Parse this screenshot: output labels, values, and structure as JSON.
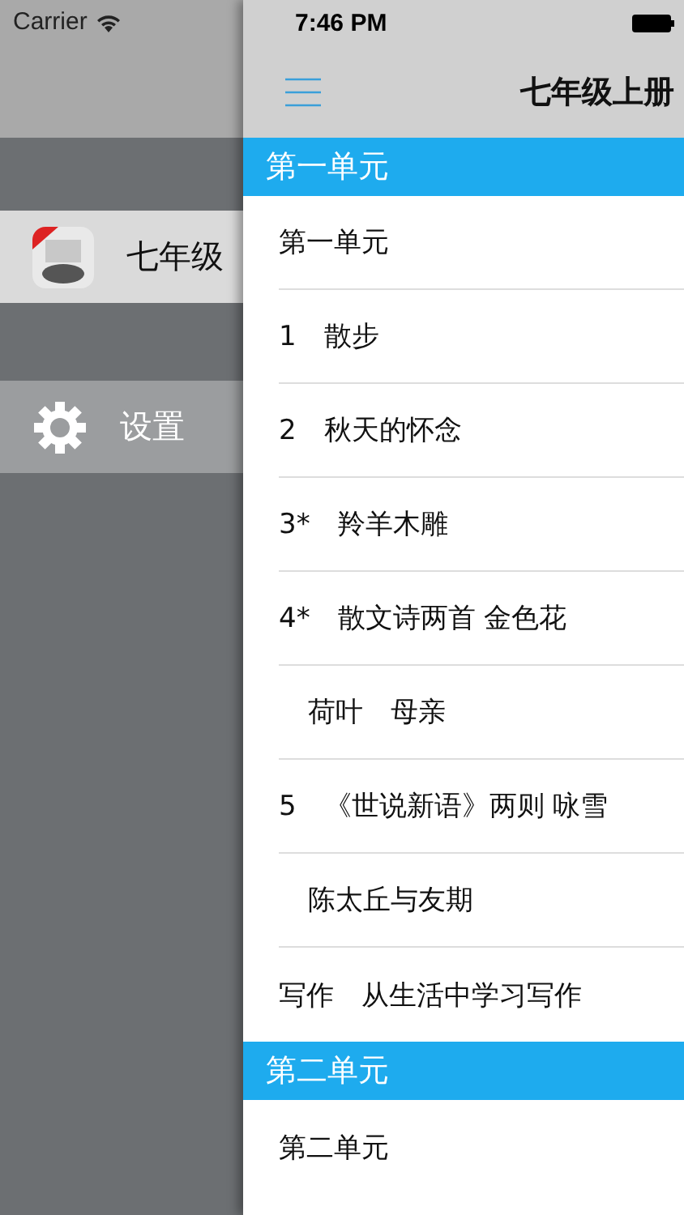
{
  "drawer": {
    "carrier": "Carrier",
    "items": [
      {
        "kind": "book",
        "label": "七年级",
        "selected": true
      },
      {
        "kind": "settings",
        "label": "设置",
        "selected": false
      }
    ]
  },
  "main": {
    "time": "7:46 PM",
    "title": "七年级上册",
    "sections": [
      {
        "header": "第一单元",
        "rows": [
          {
            "text": "第一单元",
            "indent": false
          },
          {
            "text": "1　散步",
            "indent": false
          },
          {
            "text": "2　秋天的怀念",
            "indent": false
          },
          {
            "text": "3*　羚羊木雕",
            "indent": false
          },
          {
            "text": "4*　散文诗两首 金色花",
            "indent": false
          },
          {
            "text": "荷叶　母亲",
            "indent": true
          },
          {
            "text": "5　《世说新语》两则 咏雪",
            "indent": false
          },
          {
            "text": "陈太丘与友期",
            "indent": true
          },
          {
            "text": "写作　从生活中学习写作",
            "indent": false
          }
        ]
      },
      {
        "header": "第二单元",
        "rows": [
          {
            "text": "第二单元",
            "indent": false
          }
        ]
      }
    ]
  }
}
